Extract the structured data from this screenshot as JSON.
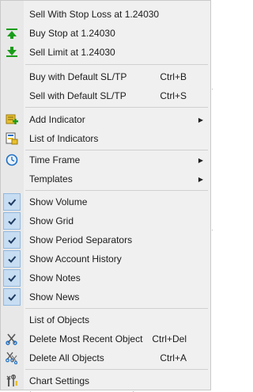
{
  "menu": {
    "items": [
      {
        "label": "Sell With Stop Loss at 1.24030",
        "shortcut": "",
        "icon": ""
      },
      {
        "label": "Buy Stop at 1.24030",
        "shortcut": "",
        "icon": "buy-stop-icon"
      },
      {
        "label": "Sell Limit at 1.24030",
        "shortcut": "",
        "icon": "sell-limit-icon"
      },
      {
        "label": "Buy with Default SL/TP",
        "shortcut": "Ctrl+B",
        "icon": ""
      },
      {
        "label": "Sell with Default SL/TP",
        "shortcut": "Ctrl+S",
        "icon": ""
      },
      {
        "label": "Add Indicator",
        "shortcut": "",
        "icon": "add-indicator-icon",
        "submenu": true
      },
      {
        "label": "List of Indicators",
        "shortcut": "",
        "icon": "list-indicators-icon"
      },
      {
        "label": "Time Frame",
        "shortcut": "",
        "icon": "clock-icon",
        "submenu": true
      },
      {
        "label": "Templates",
        "shortcut": "",
        "icon": "",
        "submenu": true
      },
      {
        "label": "Show Volume",
        "checked": true
      },
      {
        "label": "Show Grid",
        "checked": true
      },
      {
        "label": "Show Period Separators",
        "checked": true
      },
      {
        "label": "Show Account History",
        "checked": true
      },
      {
        "label": "Show Notes",
        "checked": true
      },
      {
        "label": "Show News",
        "checked": true
      },
      {
        "label": "List of Objects",
        "shortcut": "",
        "icon": ""
      },
      {
        "label": "Delete Most Recent Object",
        "shortcut": "Ctrl+Del",
        "icon": "delete-object-icon"
      },
      {
        "label": "Delete All Objects",
        "shortcut": "Ctrl+A",
        "icon": "delete-all-icon"
      },
      {
        "label": "Chart Settings",
        "shortcut": "",
        "icon": "chart-settings-icon"
      }
    ],
    "submenu_arrow": "▶",
    "check_mark": "✔"
  },
  "colors": {
    "menu_bg": "#f0f0f0",
    "gutter_bg": "#e8e8e8",
    "check_bg": "#c7ddf2",
    "check_border": "#92b8de",
    "green": "#1a9c1a",
    "blue": "#1e6fc4",
    "yellow": "#e8c12e"
  }
}
